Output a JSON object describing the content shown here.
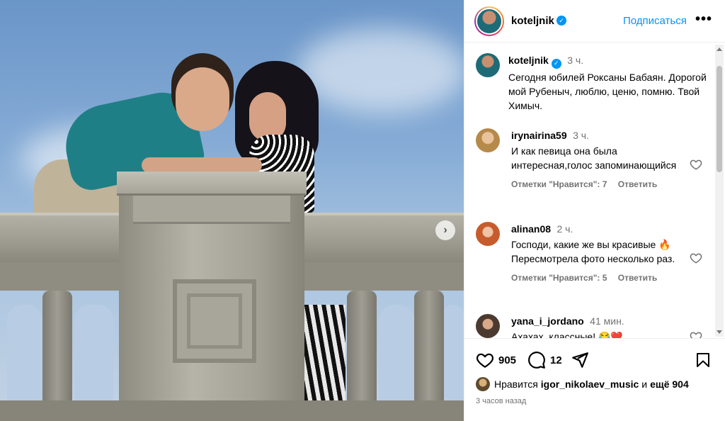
{
  "post": {
    "username": "koteljnik",
    "follow_label": "Подписаться",
    "more_label": "•••",
    "caption": {
      "username": "koteljnik",
      "time": "3 ч.",
      "text": "Сегодня юбилей Роксаны Бабаян. Дорогой мой Рубеныч, люблю, ценю, помню. Твой Химыч."
    },
    "comments": [
      {
        "username": "irynairina59",
        "time": "3 ч.",
        "text": "И как певица она была интересная,голос запоминающийся",
        "likes": "Отметки \"Нравится\": 7",
        "reply": "Ответить"
      },
      {
        "username": "alinan08",
        "time": "2 ч.",
        "text": "Господи, какие же вы красивые 🔥Пересмотрела фото несколько раз.",
        "likes": "Отметки \"Нравится\": 5",
        "reply": "Ответить"
      },
      {
        "username": "yana_i_jordano",
        "time": "41 мин.",
        "text": "Ахахах, классные! 😂❤️"
      }
    ],
    "actions": {
      "like_count": "905",
      "comment_count": "12"
    },
    "likes_row": {
      "prefix": "Нравится",
      "user": "igor_nikolaev_music",
      "middle": "и",
      "rest": "ещё 904"
    },
    "timestamp": "3 часов назад"
  },
  "colors": {
    "accent": "#0095f6",
    "muted": "#737373"
  }
}
